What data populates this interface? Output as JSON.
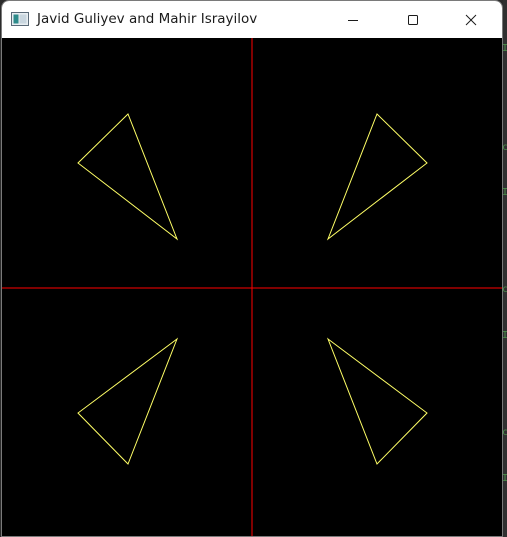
{
  "window": {
    "title": "Javid Guliyev and Mahir Israyilov",
    "controls": {
      "minimize_icon": "minimize-icon",
      "maximize_icon": "maximize-icon",
      "close_icon": "close-icon"
    }
  },
  "canvas": {
    "background": "#000000",
    "axis_color": "#ff0000",
    "shape_color": "#ffff66"
  },
  "background_glyphs": [
    "I",
    "c",
    "I",
    "c",
    "I",
    "c",
    "I"
  ]
}
